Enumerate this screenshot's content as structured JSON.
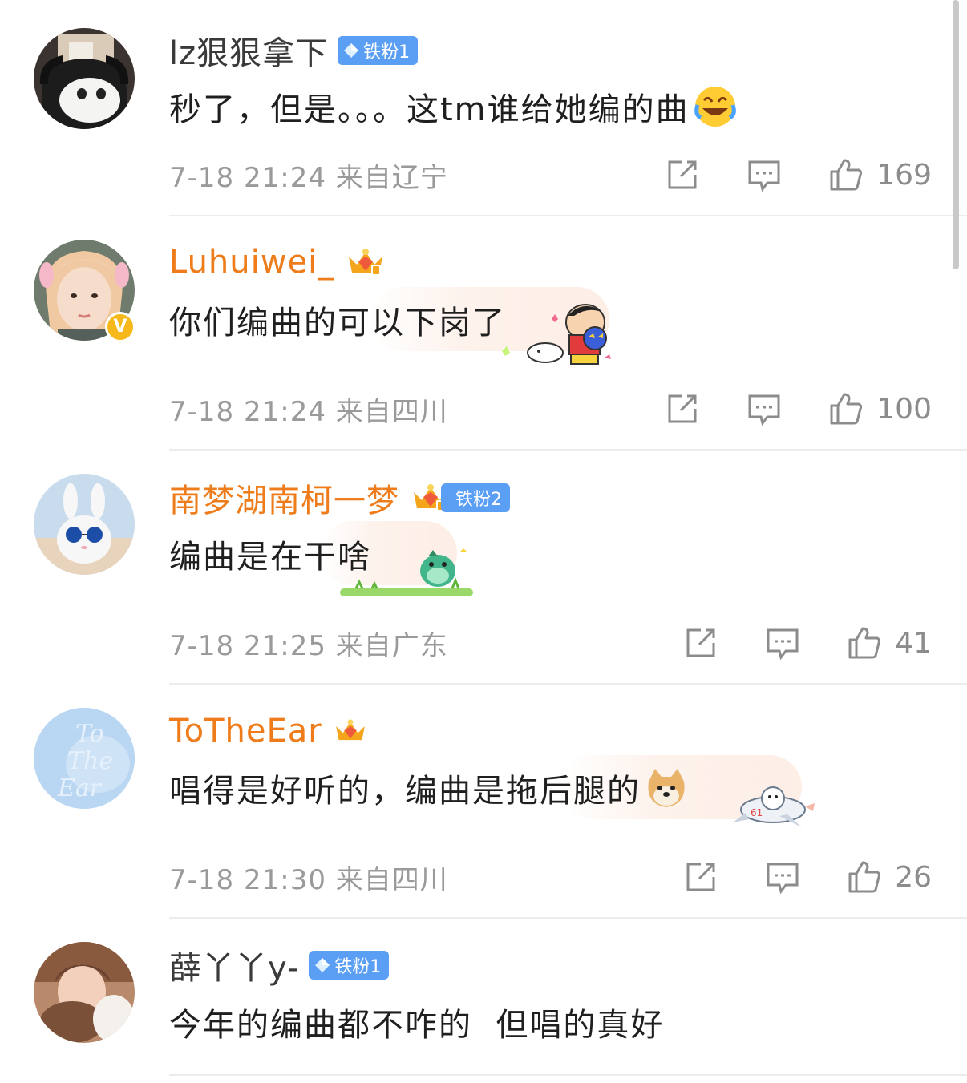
{
  "comments": [
    {
      "username": "lz狠狠拿下",
      "badge": "铁粉1",
      "text": "秒了，但是。。。这tm谁给她编的曲",
      "emoji": "laugh-cry-emoji",
      "time_location": "7-18 21:24  来自辽宁",
      "likes": "169"
    },
    {
      "username": "Luhuiwei_",
      "badge": "",
      "verified": "V",
      "text": "你们编曲的可以下岗了",
      "sticker": "crayon-shinchan-sticker",
      "time_location": "7-18 21:24  来自四川",
      "likes": "100"
    },
    {
      "username": "南梦湖南柯一梦",
      "badge": "铁粉2",
      "text": "编曲是在干啥",
      "sticker": "dinosaur-sticker",
      "time_location": "7-18 21:25  来自广东",
      "likes": "41"
    },
    {
      "username": "ToTheEar",
      "badge": "",
      "avatar_text": [
        "To",
        "The",
        "Ear"
      ],
      "text": "唱得是好听的，编曲是拖后腿的",
      "emoji": "doge-emoji",
      "sticker": "airplane-dog-sticker",
      "time_location": "7-18 21:30  来自四川",
      "likes": "26"
    },
    {
      "username": "薛丫丫y-",
      "badge": "铁粉1",
      "text": "今年的编曲都不咋的  但唱的真好"
    }
  ],
  "colors": {
    "vip_name": "#ee7c1a",
    "fan_badge": "#5b9ff5",
    "meta_text": "#9a9a9a"
  },
  "icons": {
    "repost": "share-external-icon",
    "comment": "comment-bubble-icon",
    "like": "thumbs-up-icon"
  }
}
